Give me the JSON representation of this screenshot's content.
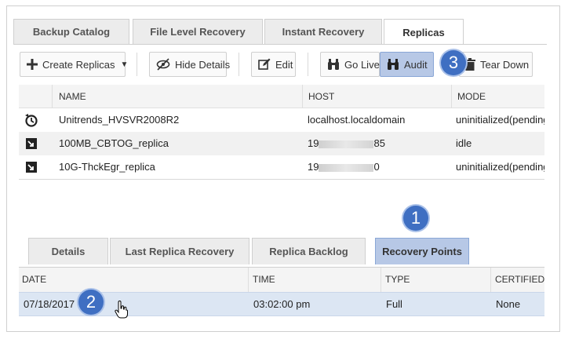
{
  "tabs": {
    "backup_catalog": "Backup Catalog",
    "file_level_recovery": "File Level Recovery",
    "instant_recovery": "Instant Recovery",
    "replicas": "Replicas"
  },
  "toolbar": {
    "create_replicas": "Create Replicas",
    "hide_details": "Hide Details",
    "edit": "Edit",
    "go_live": "Go Live",
    "audit": "Audit",
    "tear_down": "Tear Down"
  },
  "replicas_table": {
    "columns": {
      "name": "NAME",
      "host": "HOST",
      "mode": "MODE"
    },
    "rows": [
      {
        "icon": "recovery-clock-icon",
        "name": "Unitrends_HVSVR2008R2",
        "host": "localhost.localdomain",
        "mode": "uninitialized(pending:"
      },
      {
        "icon": "replica-vm-icon",
        "name": "100MB_CBTOG_replica",
        "host_start": "19",
        "host_end": "85",
        "mode": "idle"
      },
      {
        "icon": "replica-vm-icon",
        "name": "10G-ThckEgr_replica",
        "host_start": "19",
        "host_end": "0",
        "mode": "uninitialized(pending:"
      }
    ]
  },
  "detail_tabs": {
    "details": "Details",
    "last_replica_recovery": "Last Replica Recovery",
    "replica_backlog": "Replica Backlog",
    "recovery_points": "Recovery Points"
  },
  "recovery_points_table": {
    "columns": {
      "date": "DATE",
      "time": "TIME",
      "type": "TYPE",
      "certified": "CERTIFIED"
    },
    "rows": [
      {
        "date": "07/18/2017",
        "time": "03:02:00 pm",
        "type": "Full",
        "certified": "None"
      }
    ]
  },
  "callouts": {
    "one": "1",
    "two": "2",
    "three": "3"
  },
  "colors": {
    "accent": "#3f6fc2",
    "highlight": "#b7c8e6",
    "selected_row": "#dce6f3"
  }
}
